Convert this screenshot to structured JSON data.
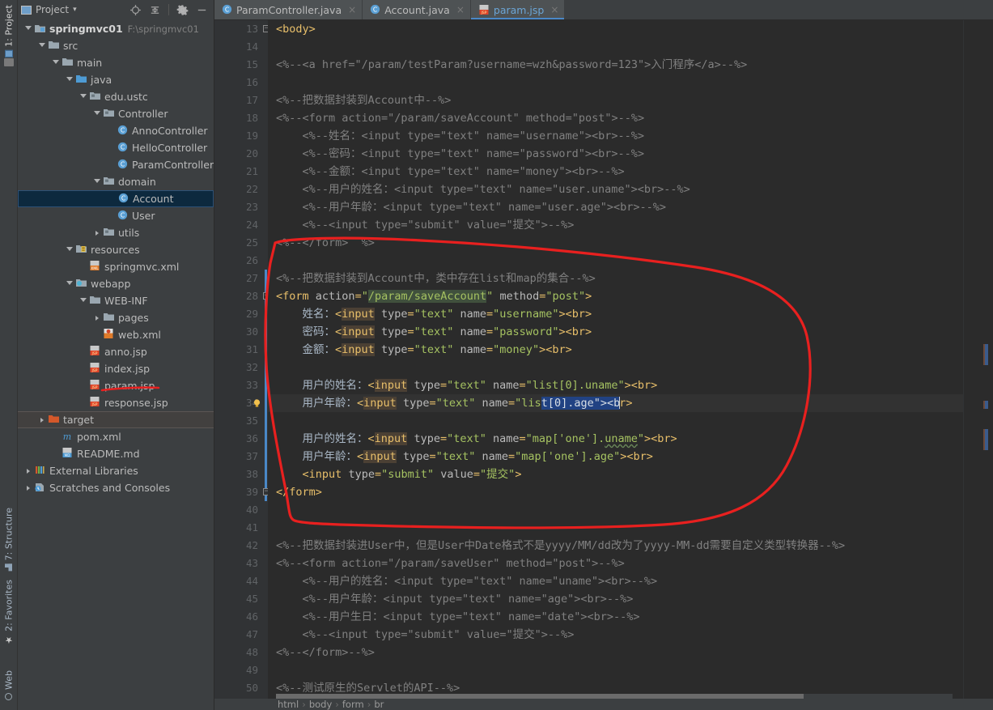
{
  "left_tool_stripe": {
    "top_items": [
      {
        "label": "1: Project",
        "icon": "project-icon",
        "active": true
      }
    ],
    "bottom_items": [
      {
        "label": "7: Structure",
        "icon": "structure-icon"
      },
      {
        "label": "2: Favorites",
        "icon": "star-icon"
      },
      {
        "label": "Web",
        "icon": "web-icon"
      }
    ]
  },
  "project_panel": {
    "title": "Project",
    "title_dropdown": "▾",
    "toolbar_icons": [
      "locate-icon",
      "collapse-all-icon",
      "gear-icon",
      "minimize-icon"
    ],
    "tree": [
      {
        "indent": 0,
        "arrow": "open",
        "icon": "module-icon",
        "label": "springmvc01",
        "sub": "F:\\springmvc01",
        "bold": true
      },
      {
        "indent": 1,
        "arrow": "open",
        "icon": "folder-icon",
        "label": "src"
      },
      {
        "indent": 2,
        "arrow": "open",
        "icon": "folder-icon",
        "label": "main"
      },
      {
        "indent": 3,
        "arrow": "open",
        "icon": "source-root-icon",
        "label": "java"
      },
      {
        "indent": 4,
        "arrow": "open",
        "icon": "package-icon",
        "label": "edu.ustc"
      },
      {
        "indent": 5,
        "arrow": "open",
        "icon": "package-icon",
        "label": "Controller"
      },
      {
        "indent": 6,
        "arrow": "none",
        "icon": "class-icon",
        "label": "AnnoController"
      },
      {
        "indent": 6,
        "arrow": "none",
        "icon": "class-icon",
        "label": "HelloController"
      },
      {
        "indent": 6,
        "arrow": "none",
        "icon": "class-icon",
        "label": "ParamController"
      },
      {
        "indent": 5,
        "arrow": "open",
        "icon": "package-icon",
        "label": "domain"
      },
      {
        "indent": 6,
        "arrow": "none",
        "icon": "class-icon",
        "label": "Account",
        "selected": true
      },
      {
        "indent": 6,
        "arrow": "none",
        "icon": "class-icon",
        "label": "User"
      },
      {
        "indent": 5,
        "arrow": "closed",
        "icon": "package-icon",
        "label": "utils"
      },
      {
        "indent": 3,
        "arrow": "open",
        "icon": "resources-icon",
        "label": "resources"
      },
      {
        "indent": 4,
        "arrow": "none",
        "icon": "xml-icon",
        "label": "springmvc.xml"
      },
      {
        "indent": 3,
        "arrow": "open",
        "icon": "webapp-icon",
        "label": "webapp"
      },
      {
        "indent": 4,
        "arrow": "open",
        "icon": "folder-icon",
        "label": "WEB-INF"
      },
      {
        "indent": 5,
        "arrow": "closed",
        "icon": "folder-icon",
        "label": "pages"
      },
      {
        "indent": 5,
        "arrow": "none",
        "icon": "webxml-icon",
        "label": "web.xml"
      },
      {
        "indent": 4,
        "arrow": "none",
        "icon": "jsp-icon",
        "label": "anno.jsp"
      },
      {
        "indent": 4,
        "arrow": "none",
        "icon": "jsp-icon",
        "label": "index.jsp"
      },
      {
        "indent": 4,
        "arrow": "none",
        "icon": "jsp-icon",
        "label": "param.jsp",
        "underlined_red": true
      },
      {
        "indent": 4,
        "arrow": "none",
        "icon": "jsp-icon",
        "label": "response.jsp"
      },
      {
        "indent": 1,
        "arrow": "closed",
        "icon": "target-folder-icon",
        "label": "target",
        "hilite": true
      },
      {
        "indent": 2,
        "arrow": "none",
        "icon": "maven-icon",
        "label": "pom.xml"
      },
      {
        "indent": 2,
        "arrow": "none",
        "icon": "md-icon",
        "label": "README.md"
      },
      {
        "indent": 0,
        "arrow": "closed",
        "icon": "libraries-icon",
        "label": "External Libraries"
      },
      {
        "indent": 0,
        "arrow": "closed",
        "icon": "scratches-icon",
        "label": "Scratches and Consoles"
      }
    ]
  },
  "editor": {
    "tabs": [
      {
        "label": "ParamController.java",
        "icon": "class-icon",
        "active": false,
        "close": "×"
      },
      {
        "label": "Account.java",
        "icon": "class-icon",
        "active": false,
        "close": "×"
      },
      {
        "label": "param.jsp",
        "icon": "jsp-icon",
        "active": true,
        "close": "×"
      }
    ],
    "first_line_number": 13,
    "lines": [
      {
        "n": 13,
        "fold": "open",
        "tokens": [
          {
            "t": "tag",
            "s": "<body>"
          }
        ]
      },
      {
        "n": 14,
        "tokens": []
      },
      {
        "n": 15,
        "tokens": [
          {
            "t": "cmt",
            "s": "<%--<a href=\"/param/testParam?username=wzh&password=123\">入门程序</a>--%>"
          }
        ]
      },
      {
        "n": 16,
        "tokens": []
      },
      {
        "n": 17,
        "tokens": [
          {
            "t": "cmt",
            "s": "<%--把数据封装到Account中--%>"
          }
        ]
      },
      {
        "n": 18,
        "tokens": [
          {
            "t": "cmt",
            "s": "<%--<form action=\"/param/saveAccount\" method=\"post\">--%>"
          }
        ]
      },
      {
        "n": 19,
        "tokens": [
          {
            "t": "cmt",
            "s": "    <%--姓名：<input type=\"text\" name=\"username\"><br>--%>"
          }
        ]
      },
      {
        "n": 20,
        "tokens": [
          {
            "t": "cmt",
            "s": "    <%--密码：<input type=\"text\" name=\"password\"><br>--%>"
          }
        ]
      },
      {
        "n": 21,
        "tokens": [
          {
            "t": "cmt",
            "s": "    <%--金额：<input type=\"text\" name=\"money\"><br>--%>"
          }
        ]
      },
      {
        "n": 22,
        "tokens": [
          {
            "t": "cmt",
            "s": "    <%--用户的姓名：<input type=\"text\" name=\"user.uname\"><br>--%>"
          }
        ]
      },
      {
        "n": 23,
        "tokens": [
          {
            "t": "cmt",
            "s": "    <%--用户年龄：<input type=\"text\" name=\"user.age\"><br>--%>"
          }
        ]
      },
      {
        "n": 24,
        "tokens": [
          {
            "t": "cmt",
            "s": "    <%--<input type=\"submit\" value=\"提交\">--%>"
          }
        ]
      },
      {
        "n": 25,
        "tokens": [
          {
            "t": "cmt",
            "s": "<%--</form>  %>"
          }
        ]
      },
      {
        "n": 26,
        "tokens": []
      },
      {
        "n": 27,
        "change": true,
        "tokens": [
          {
            "t": "cmt",
            "s": "<%--把数据封装到Account中，类中存在list和map的集合--%>"
          }
        ]
      },
      {
        "n": 28,
        "change": true,
        "fold": "open",
        "tokens": [
          {
            "t": "tag",
            "s": "<form"
          },
          {
            "t": "txt",
            "s": " "
          },
          {
            "t": "attr",
            "s": "action"
          },
          {
            "t": "tag",
            "s": "="
          },
          {
            "t": "val",
            "s": "\""
          },
          {
            "t": "val hl-green",
            "s": "/param/saveAccount"
          },
          {
            "t": "val",
            "s": "\""
          },
          {
            "t": "txt",
            "s": " "
          },
          {
            "t": "attr",
            "s": "method"
          },
          {
            "t": "tag",
            "s": "="
          },
          {
            "t": "val",
            "s": "\"post\""
          },
          {
            "t": "tag",
            "s": ">"
          }
        ]
      },
      {
        "n": 29,
        "change": true,
        "tokens": [
          {
            "t": "txt",
            "s": "    姓名："
          },
          {
            "t": "tag",
            "s": "<"
          },
          {
            "t": "tag hl-tan",
            "s": "input"
          },
          {
            "t": "txt",
            "s": " "
          },
          {
            "t": "attr",
            "s": "type"
          },
          {
            "t": "tag",
            "s": "="
          },
          {
            "t": "val",
            "s": "\"text\""
          },
          {
            "t": "txt",
            "s": " "
          },
          {
            "t": "attr",
            "s": "name"
          },
          {
            "t": "tag",
            "s": "="
          },
          {
            "t": "val",
            "s": "\"username\""
          },
          {
            "t": "tag",
            "s": "><br>"
          }
        ]
      },
      {
        "n": 30,
        "change": true,
        "tokens": [
          {
            "t": "txt",
            "s": "    密码："
          },
          {
            "t": "tag",
            "s": "<"
          },
          {
            "t": "tag hl-tan",
            "s": "input"
          },
          {
            "t": "txt",
            "s": " "
          },
          {
            "t": "attr",
            "s": "type"
          },
          {
            "t": "tag",
            "s": "="
          },
          {
            "t": "val",
            "s": "\"text\""
          },
          {
            "t": "txt",
            "s": " "
          },
          {
            "t": "attr",
            "s": "name"
          },
          {
            "t": "tag",
            "s": "="
          },
          {
            "t": "val",
            "s": "\"password\""
          },
          {
            "t": "tag",
            "s": "><br>"
          }
        ]
      },
      {
        "n": 31,
        "change": true,
        "tokens": [
          {
            "t": "txt",
            "s": "    金额："
          },
          {
            "t": "tag",
            "s": "<"
          },
          {
            "t": "tag hl-tan",
            "s": "input"
          },
          {
            "t": "txt",
            "s": " "
          },
          {
            "t": "attr",
            "s": "type"
          },
          {
            "t": "tag",
            "s": "="
          },
          {
            "t": "val",
            "s": "\"text\""
          },
          {
            "t": "txt",
            "s": " "
          },
          {
            "t": "attr",
            "s": "name"
          },
          {
            "t": "tag",
            "s": "="
          },
          {
            "t": "val",
            "s": "\"money\""
          },
          {
            "t": "tag",
            "s": "><br>"
          }
        ]
      },
      {
        "n": 32,
        "change": true,
        "tokens": []
      },
      {
        "n": 33,
        "change": true,
        "tokens": [
          {
            "t": "txt",
            "s": "    用户的姓名："
          },
          {
            "t": "tag",
            "s": "<"
          },
          {
            "t": "tag hl-tan",
            "s": "input"
          },
          {
            "t": "txt",
            "s": " "
          },
          {
            "t": "attr",
            "s": "type"
          },
          {
            "t": "tag",
            "s": "="
          },
          {
            "t": "val",
            "s": "\"text\""
          },
          {
            "t": "txt",
            "s": " "
          },
          {
            "t": "attr",
            "s": "name"
          },
          {
            "t": "tag",
            "s": "="
          },
          {
            "t": "val",
            "s": "\"list[0].uname\""
          },
          {
            "t": "tag",
            "s": "><br>"
          }
        ]
      },
      {
        "n": 34,
        "change": true,
        "current": true,
        "bulb": true,
        "tokens": [
          {
            "t": "txt",
            "s": "    用户年龄："
          },
          {
            "t": "tag",
            "s": "<"
          },
          {
            "t": "tag hl-tan",
            "s": "input"
          },
          {
            "t": "txt",
            "s": " "
          },
          {
            "t": "attr",
            "s": "type"
          },
          {
            "t": "tag",
            "s": "="
          },
          {
            "t": "val",
            "s": "\"text\""
          },
          {
            "t": "txt",
            "s": " "
          },
          {
            "t": "attr",
            "s": "name"
          },
          {
            "t": "tag",
            "s": "="
          },
          {
            "t": "val",
            "s": "\"lis"
          },
          {
            "t": "sel",
            "s": "t[0].age\"><b"
          },
          {
            "t": "caret",
            "s": ""
          },
          {
            "t": "tag",
            "s": "r>"
          }
        ]
      },
      {
        "n": 35,
        "change": true,
        "tokens": []
      },
      {
        "n": 36,
        "change": true,
        "tokens": [
          {
            "t": "txt",
            "s": "    用户的姓名："
          },
          {
            "t": "tag",
            "s": "<"
          },
          {
            "t": "tag hl-tan",
            "s": "input"
          },
          {
            "t": "txt",
            "s": " "
          },
          {
            "t": "attr",
            "s": "type"
          },
          {
            "t": "tag",
            "s": "="
          },
          {
            "t": "val",
            "s": "\"text\""
          },
          {
            "t": "txt",
            "s": " "
          },
          {
            "t": "attr",
            "s": "name"
          },
          {
            "t": "tag",
            "s": "="
          },
          {
            "t": "val",
            "s": "\"map['one']."
          },
          {
            "t": "val wavy",
            "s": "uname"
          },
          {
            "t": "val",
            "s": "\""
          },
          {
            "t": "tag",
            "s": "><br>"
          }
        ]
      },
      {
        "n": 37,
        "change": true,
        "tokens": [
          {
            "t": "txt",
            "s": "    用户年龄："
          },
          {
            "t": "tag",
            "s": "<"
          },
          {
            "t": "tag hl-tan",
            "s": "input"
          },
          {
            "t": "txt",
            "s": " "
          },
          {
            "t": "attr",
            "s": "type"
          },
          {
            "t": "tag",
            "s": "="
          },
          {
            "t": "val",
            "s": "\"text\""
          },
          {
            "t": "txt",
            "s": " "
          },
          {
            "t": "attr",
            "s": "name"
          },
          {
            "t": "tag",
            "s": "="
          },
          {
            "t": "val",
            "s": "\"map['one'].age\""
          },
          {
            "t": "tag",
            "s": "><br>"
          }
        ]
      },
      {
        "n": 38,
        "change": true,
        "tokens": [
          {
            "t": "txt",
            "s": "    "
          },
          {
            "t": "tag",
            "s": "<input"
          },
          {
            "t": "txt",
            "s": " "
          },
          {
            "t": "attr",
            "s": "type"
          },
          {
            "t": "tag",
            "s": "="
          },
          {
            "t": "val",
            "s": "\"submit\""
          },
          {
            "t": "txt",
            "s": " "
          },
          {
            "t": "attr",
            "s": "value"
          },
          {
            "t": "tag",
            "s": "="
          },
          {
            "t": "val",
            "s": "\"提交\""
          },
          {
            "t": "tag",
            "s": ">"
          }
        ]
      },
      {
        "n": 39,
        "change": true,
        "fold": "open",
        "tokens": [
          {
            "t": "tag",
            "s": "</form>"
          }
        ]
      },
      {
        "n": 40,
        "tokens": []
      },
      {
        "n": 41,
        "tokens": []
      },
      {
        "n": 42,
        "tokens": [
          {
            "t": "cmt",
            "s": "<%--把数据封装进User中，但是User中Date格式不是yyyy/MM/dd改为了yyyy-MM-dd需要自定义类型转换器--%>"
          }
        ]
      },
      {
        "n": 43,
        "tokens": [
          {
            "t": "cmt",
            "s": "<%--<form action=\"/param/saveUser\" method=\"post\">--%>"
          }
        ]
      },
      {
        "n": 44,
        "tokens": [
          {
            "t": "cmt",
            "s": "    <%--用户的姓名：<input type=\"text\" name=\"uname\"><br>--%>"
          }
        ]
      },
      {
        "n": 45,
        "tokens": [
          {
            "t": "cmt",
            "s": "    <%--用户年龄：<input type=\"text\" name=\"age\"><br>--%>"
          }
        ]
      },
      {
        "n": 46,
        "tokens": [
          {
            "t": "cmt",
            "s": "    <%--用户生日：<input type=\"text\" name=\"date\"><br>--%>"
          }
        ]
      },
      {
        "n": 47,
        "tokens": [
          {
            "t": "cmt",
            "s": "    <%--<input type=\"submit\" value=\"提交\">--%>"
          }
        ]
      },
      {
        "n": 48,
        "tokens": [
          {
            "t": "cmt",
            "s": "<%--</form>--%>"
          }
        ]
      },
      {
        "n": 49,
        "tokens": []
      },
      {
        "n": 50,
        "tokens": [
          {
            "t": "cmt",
            "s": "<%--测试原生的Servlet的API--%>"
          }
        ]
      }
    ],
    "breadcrumbs": [
      "html",
      "body",
      "form",
      "br"
    ],
    "breadcrumb_separator": "›"
  },
  "annotation": {
    "color": "#e8201f",
    "description": "hand-drawn red ellipse around the active form block and a red underline under param.jsp"
  },
  "colors": {
    "background": "#3c3f41",
    "editor_background": "#2b2b2b",
    "gutter": "#313335",
    "tag": "#e8bf6a",
    "attribute_value": "#a5c261",
    "comment": "#808080",
    "text": "#a9b7c6",
    "selection": "#214283",
    "tab_active_underline": "#4a88c7",
    "tree_selection": "#0d293e",
    "annotation_red": "#e8201f"
  }
}
